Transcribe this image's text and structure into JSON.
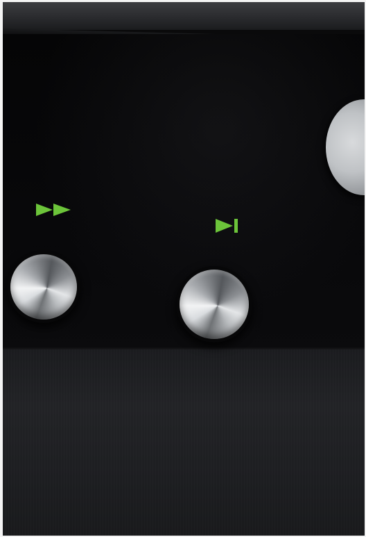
{
  "scene": {
    "controls": [
      {
        "id": "fast-forward",
        "icon": "fast-forward-icon",
        "label_color": "#6cc43a"
      },
      {
        "id": "skip-next",
        "icon": "skip-next-icon",
        "label_color": "#6cc43a"
      }
    ],
    "colors": {
      "panel": "#08080a",
      "lower_panel": "#1f2023",
      "metal": "#c9ccce",
      "accent_green": "#6cc43a"
    }
  }
}
